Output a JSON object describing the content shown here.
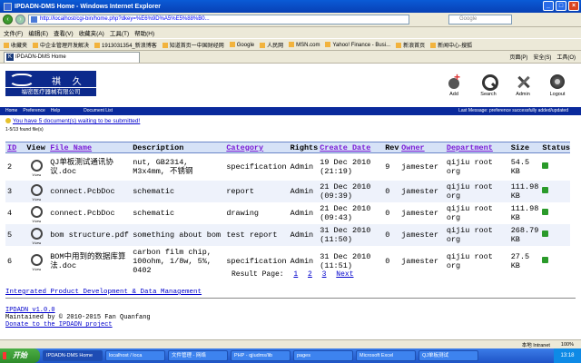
{
  "window": {
    "title": "IPDADN-DMS Home - Windows Internet Explorer"
  },
  "browser": {
    "url": "http://localhost/cgi-bin/home.php?dkey=%E6%9D%A5%E5%88%B0...",
    "search_placeholder": "Google",
    "menu": [
      "文件(F)",
      "编辑(E)",
      "查看(V)",
      "收藏夹(A)",
      "工具(T)",
      "帮助(H)"
    ],
    "favorites": [
      "收藏夹",
      "中企业管理开发解决",
      "1913031354_新浪博客",
      "知道首页一中国财经网",
      "Google",
      "人民网",
      "MSN.com",
      "Yahoo! Finance - Busi...",
      "新浪首页",
      "新闻中心-搜狐"
    ],
    "tab_label": "IPDADN-DMS Home",
    "tab_tools": [
      "页面(P)",
      "安全(S)",
      "工具(O)"
    ]
  },
  "header": {
    "logo_text": "祺 久",
    "logo_subtitle": "福密医疗器械有限公司",
    "icons": [
      {
        "icon": "add-icon",
        "label": "Add"
      },
      {
        "icon": "search-icon",
        "label": "Search"
      },
      {
        "icon": "admin-icon",
        "label": "Admin"
      },
      {
        "icon": "logout-icon",
        "label": "Logout"
      }
    ]
  },
  "nav": {
    "items": [
      "Home",
      "Preference",
      "Help"
    ],
    "doclist": "Document List",
    "message": "Last Message: preference successfully added/updated"
  },
  "pending_notice": "You have 5 document(s) waiting to be submitted!",
  "found_text": "1-5/13 found file(s)",
  "table": {
    "headers": [
      "ID",
      "View",
      "File Name",
      "Description",
      "Category",
      "Rights",
      "Create Date",
      "Rev",
      "Owner",
      "Department",
      "Size",
      "Status"
    ],
    "view_label": "View",
    "rows": [
      {
        "id": "2",
        "file": "QJ单板测试通讯协议.doc",
        "desc": "nut, GB2314, M3x4mm, 不锈钢",
        "category": "specification",
        "rights": "Admin",
        "date": "19 Dec 2010 (21:19)",
        "rev": "9",
        "owner": "jamester",
        "dept": "qijiu root org",
        "size": "54.5 KB"
      },
      {
        "id": "3",
        "file": "connect.PcbDoc",
        "desc": "schematic",
        "category": "report",
        "rights": "Admin",
        "date": "21 Dec 2010 (09:39)",
        "rev": "0",
        "owner": "jamester",
        "dept": "qijiu root org",
        "size": "111.98 KB"
      },
      {
        "id": "4",
        "file": "connect.PcbDoc",
        "desc": "schematic",
        "category": "drawing",
        "rights": "Admin",
        "date": "21 Dec 2010 (09:43)",
        "rev": "0",
        "owner": "jamester",
        "dept": "qijiu root org",
        "size": "111.98 KB"
      },
      {
        "id": "5",
        "file": "bom structure.pdf",
        "desc": "something about bom",
        "category": "test report",
        "rights": "Admin",
        "date": "31 Dec 2010 (11:50)",
        "rev": "0",
        "owner": "jamester",
        "dept": "qijiu root org",
        "size": "268.79 KB"
      },
      {
        "id": "6",
        "file": "BOM中用到的数据库算法.doc",
        "desc": "carbon film chip, 100ohm, 1/8w, 5%, 0402",
        "category": "specification",
        "rights": "Admin",
        "date": "31 Dec 2010 (11:51)",
        "rev": "0",
        "owner": "jamester",
        "dept": "qijiu root org",
        "size": "27.5 KB"
      }
    ]
  },
  "pager": {
    "label": "Result Page:",
    "pages": [
      "1",
      "2",
      "3"
    ],
    "next": "Next"
  },
  "footer": {
    "link": "Integrated Product Development & Data Management",
    "version": "IPDADN v1.0.0",
    "maintained": "Maintained by © 2010-2015 Fan Quanfang",
    "donate": "Donate to the IPDADN project"
  },
  "statusbar": {
    "zone": "本地 Intranet",
    "zoom": "100%"
  },
  "taskbar": {
    "start": "开始",
    "tasks": [
      "IPDADN-DMS Home",
      "localhost / loca",
      "文件管理 - 网络",
      "PHP - qjiudms/lib",
      "pages",
      "Microsoft Excel",
      "QJ单板测试"
    ],
    "clock": "13:18"
  }
}
